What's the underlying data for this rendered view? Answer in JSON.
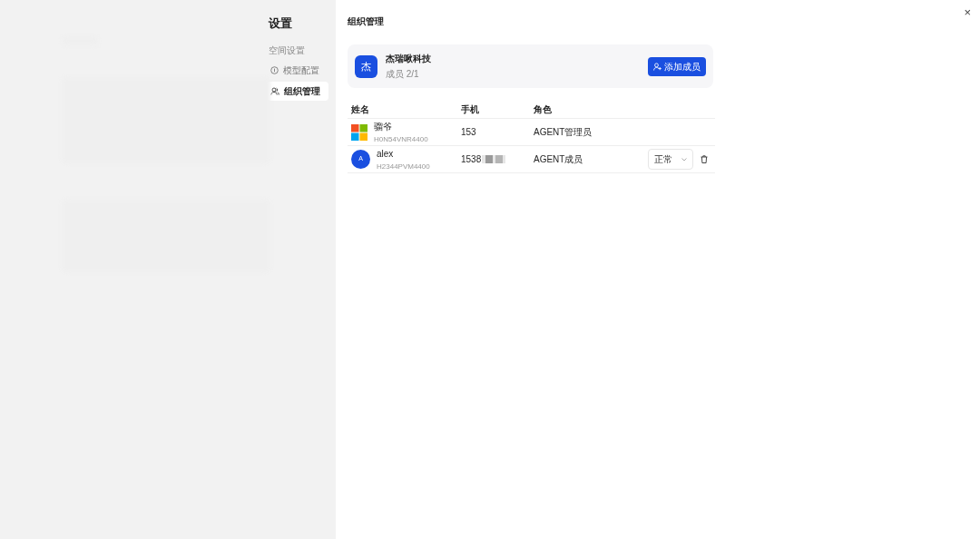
{
  "settings_sidebar": {
    "title": "设置",
    "group_label": "空间设置",
    "items": [
      {
        "label": "模型配置",
        "kind": "info",
        "selected": false
      },
      {
        "label": "组织管理",
        "kind": "people",
        "selected": true
      }
    ]
  },
  "main": {
    "title": "组织管理",
    "organization": {
      "avatar_letter": "杰",
      "name": "杰瑞啾科技",
      "members": "成员 2/1",
      "add_button": "添加成员"
    },
    "table": {
      "columns": [
        "姓名",
        "手机",
        "角色"
      ],
      "rows": [
        {
          "kind": "tiles",
          "name": "骝爷",
          "id": "H0N54VNR4400",
          "phone": "153",
          "phone_redacted": false,
          "role": "AGENT管理员"
        },
        {
          "kind": "letter",
          "avatar_letter": "A",
          "name": "alex",
          "id": "H2344PVM4400",
          "phone": "1538",
          "phone_redacted": true,
          "role": "AGENT成员",
          "status": "正常"
        }
      ]
    }
  },
  "close_button": "×"
}
